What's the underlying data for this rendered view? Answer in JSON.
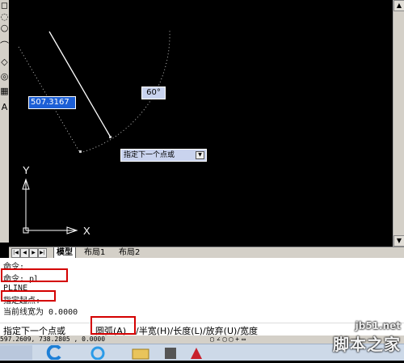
{
  "command_input": {
    "length_value": "507.3167",
    "angle_value": "60°",
    "tooltip_prompt": "指定下一个点或",
    "dropdown_icon": "down-arrow"
  },
  "ucs": {
    "y_label": "Y",
    "x_label": "X"
  },
  "layout_tabs": [
    "模型",
    "布局1",
    "布局2"
  ],
  "command_history": [
    "命令:",
    "命令: pl",
    "PLINE",
    "指定起点:",
    "当前线宽为 0.0000"
  ],
  "command_prompt": {
    "prefix": "指定下一个点或",
    "arc": "圆弧(A)",
    "options": "/半宽(H)/长度(L)/放弃(U)/宽度"
  },
  "status_bar": {
    "coordinates": "597.2609, 738.2805 , 0.0000"
  },
  "watermark": {
    "site": "jb51.net",
    "brand": "脚本之家"
  },
  "colors": {
    "highlight": "#d40000",
    "canvas": "#000000"
  }
}
